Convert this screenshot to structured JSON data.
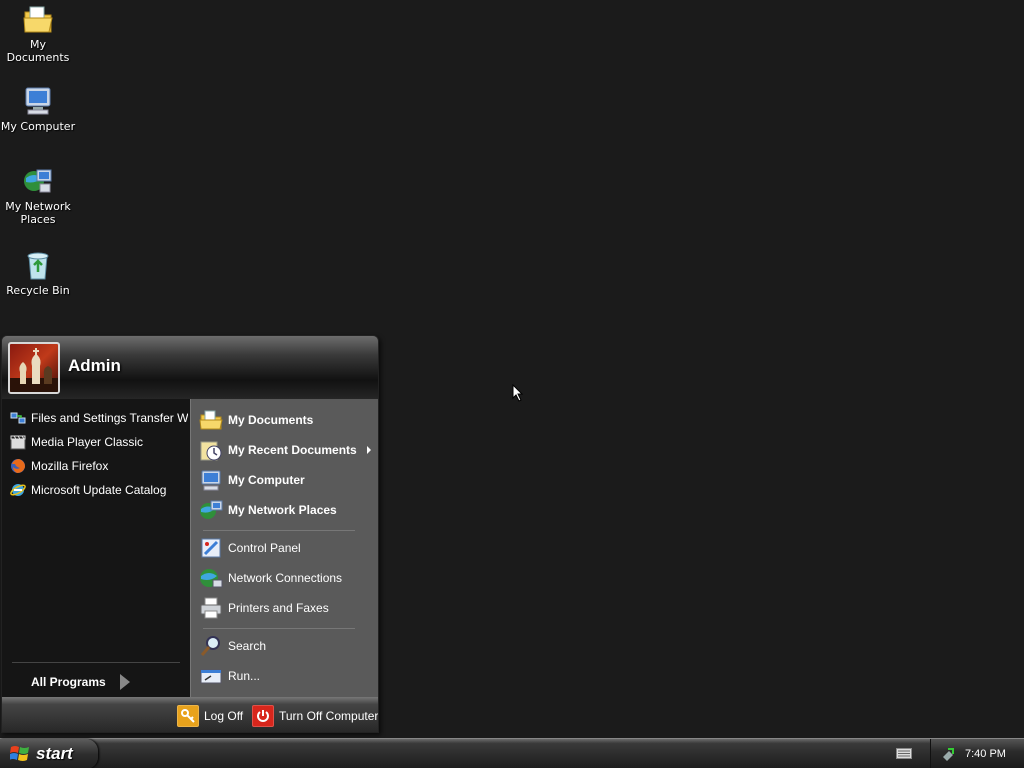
{
  "desktop": {
    "icons": [
      {
        "label": "My Documents"
      },
      {
        "label": "My Computer"
      },
      {
        "label": "My Network Places"
      },
      {
        "label": "Recycle Bin"
      }
    ]
  },
  "start_menu": {
    "username": "Admin",
    "pinned": [
      {
        "label": "Files and Settings Transfer W...",
        "icon": "transfer-wizard-icon"
      },
      {
        "label": "Media Player Classic",
        "icon": "media-player-icon"
      },
      {
        "label": "Mozilla Firefox",
        "icon": "firefox-icon"
      },
      {
        "label": "Microsoft Update Catalog",
        "icon": "internet-explorer-icon"
      }
    ],
    "all_programs": "All Programs",
    "places": [
      {
        "label": "My Documents",
        "icon": "folder-documents-icon"
      },
      {
        "label": "My Recent Documents",
        "icon": "recent-documents-icon"
      },
      {
        "label": "My Computer",
        "icon": "computer-icon"
      },
      {
        "label": "My Network Places",
        "icon": "network-places-icon"
      }
    ],
    "system": [
      {
        "label": "Control Panel",
        "icon": "control-panel-icon"
      },
      {
        "label": "Network Connections",
        "icon": "network-connections-icon"
      },
      {
        "label": "Printers and Faxes",
        "icon": "printer-icon"
      }
    ],
    "tools": [
      {
        "label": "Search",
        "icon": "search-icon"
      },
      {
        "label": "Run...",
        "icon": "run-icon"
      }
    ],
    "log_off": "Log Off",
    "turn_off": "Turn Off Computer"
  },
  "taskbar": {
    "start_label": "start",
    "clock": "7:40 PM"
  },
  "colors": {
    "desktop_bg": "#1b1b1b",
    "menu_left_bg": "#151515",
    "menu_right_bg": "#5a5a5a",
    "logoff_icon": "#e8a21c",
    "shutdown_icon": "#d8261c"
  }
}
